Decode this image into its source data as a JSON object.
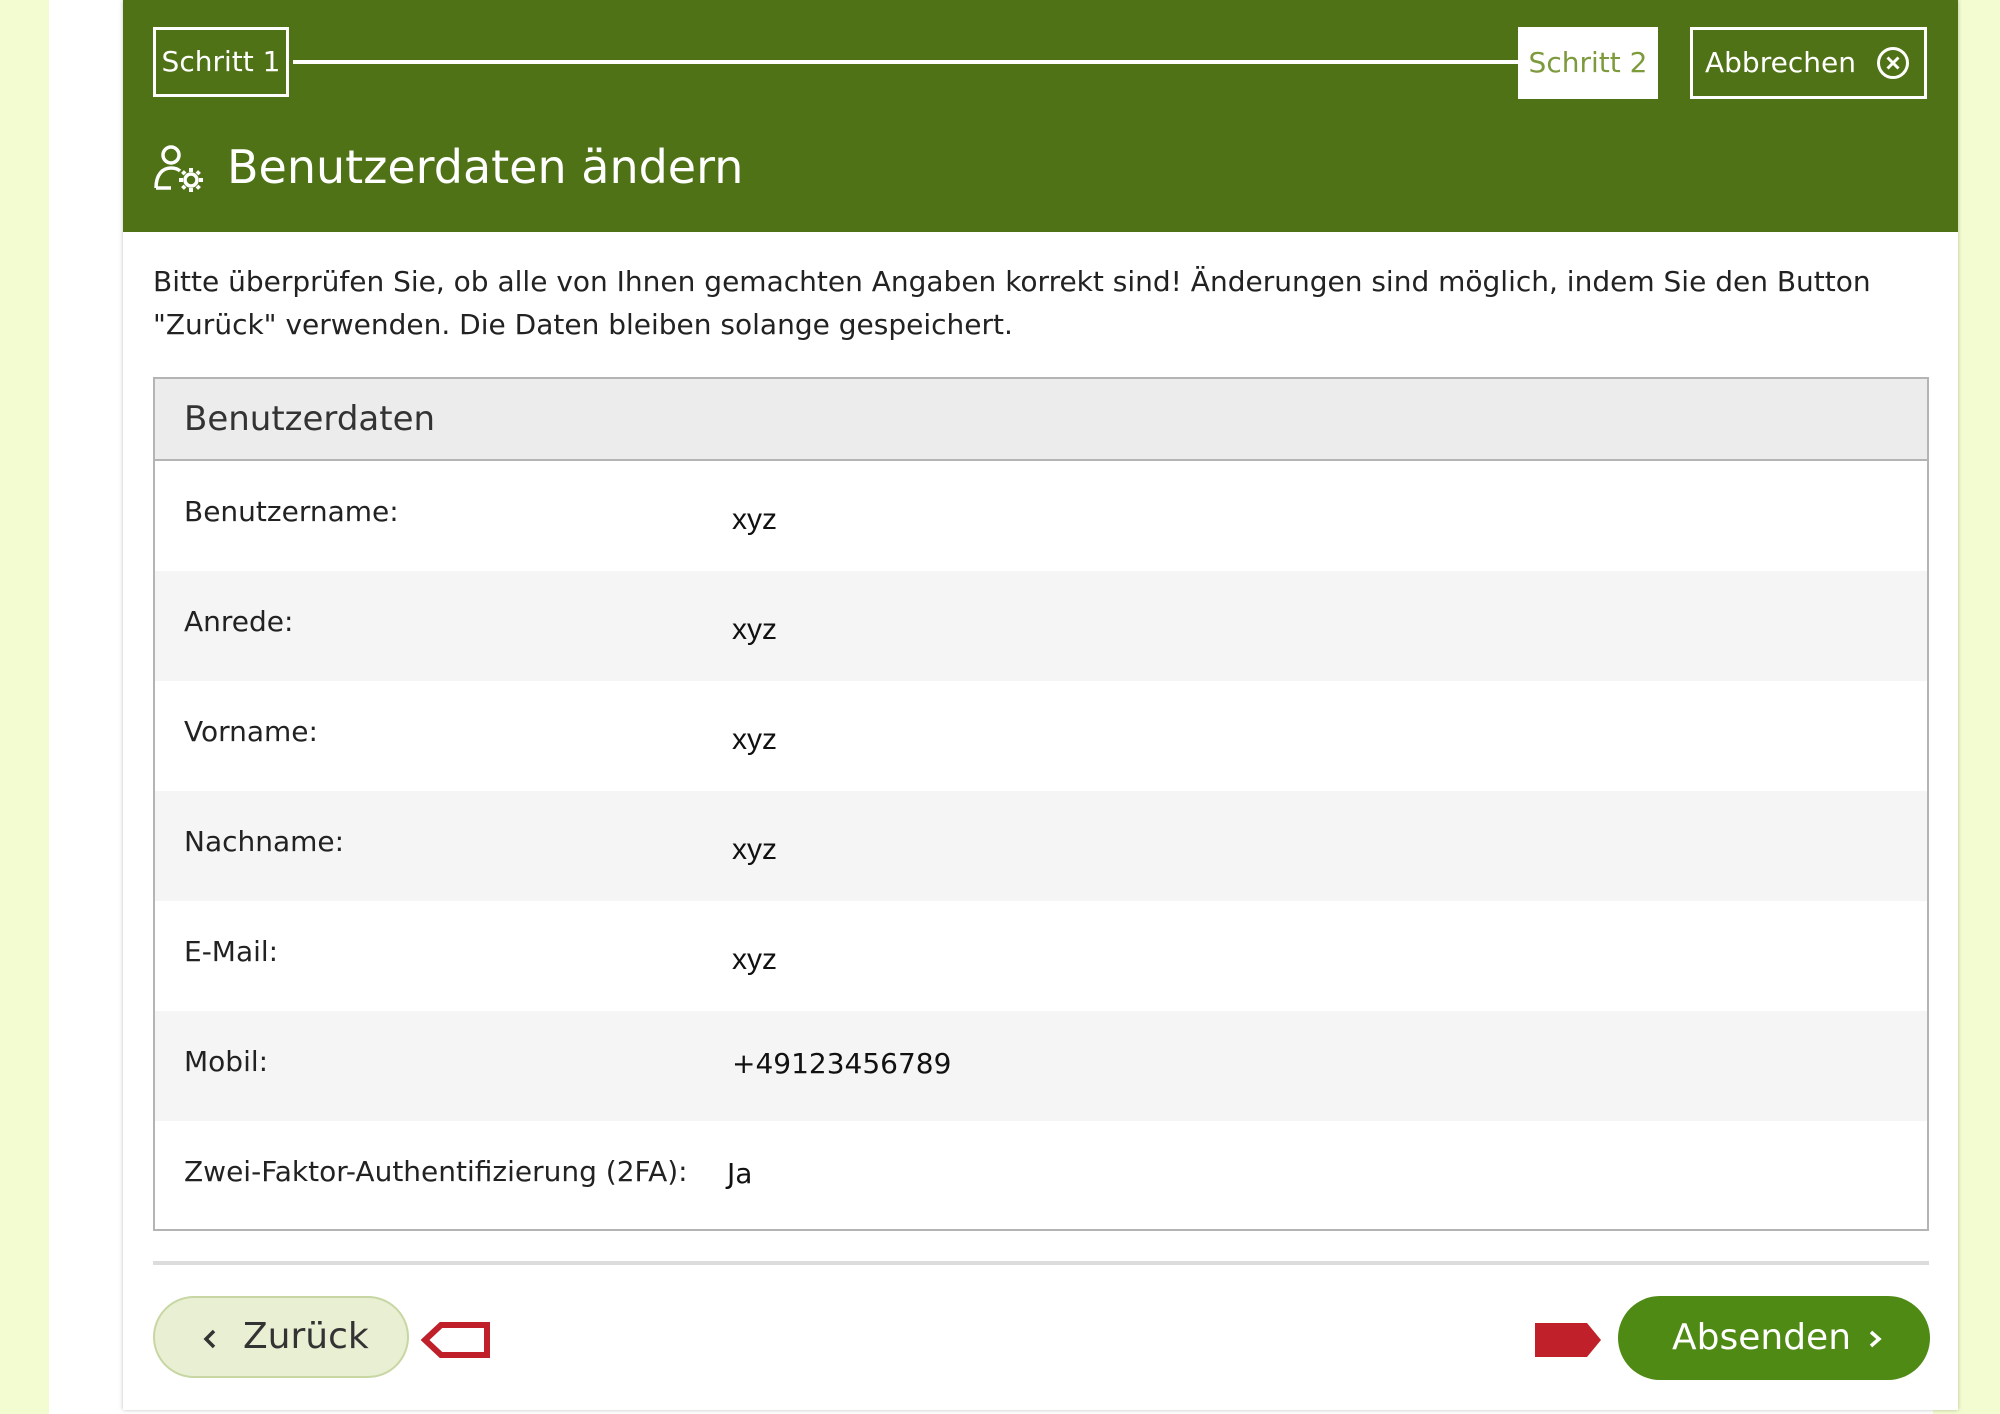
{
  "wizard": {
    "step1_label": "Schritt 1",
    "step2_label": "Schritt 2",
    "cancel_label": "Abbrechen"
  },
  "page": {
    "title": "Benutzerdaten ändern",
    "instructions": "Bitte überprüfen Sie, ob alle von Ihnen gemachten Angaben korrekt sind! Änderungen sind möglich, indem Sie den Button \"Zurück\" verwenden. Die Daten bleiben solange gespeichert."
  },
  "panel": {
    "heading": "Benutzerdaten",
    "rows": [
      {
        "label": "Benutzername:",
        "value": "xyz"
      },
      {
        "label": "Anrede:",
        "value": "xyz"
      },
      {
        "label": "Vorname:",
        "value": "xyz"
      },
      {
        "label": "Nachname:",
        "value": "xyz"
      },
      {
        "label": "E-Mail:",
        "value": "xyz"
      },
      {
        "label": "Mobil:",
        "value": "+49123456789"
      },
      {
        "label": "Zwei-Faktor-Authentifizierung (2FA):",
        "value": "Ja"
      }
    ]
  },
  "actions": {
    "back_label": "Zurück",
    "submit_label": "Absenden"
  },
  "colors": {
    "header_green": "#4e7215",
    "submit_green": "#4e8a14",
    "arrow_red": "#c0202a",
    "page_background": "#f3fcd0"
  }
}
